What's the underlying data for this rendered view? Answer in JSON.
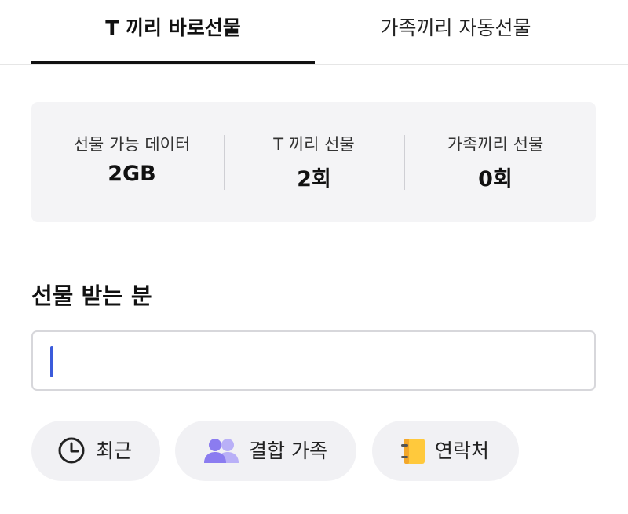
{
  "tabs": {
    "active_label": "T 끼리 바로선물",
    "inactive_label": "가족끼리 자동선물"
  },
  "stats": [
    {
      "label": "선물 가능 데이터",
      "value": "2GB"
    },
    {
      "label": "T 끼리 선물",
      "value": "2회"
    },
    {
      "label": "가족끼리 선물",
      "value": "0회"
    }
  ],
  "recipient": {
    "title": "선물 받는 분",
    "input_value": "",
    "input_placeholder": ""
  },
  "shortcuts": [
    {
      "label": "최근",
      "icon": "clock-icon"
    },
    {
      "label": "결합 가족",
      "icon": "people-icon"
    },
    {
      "label": "연락처",
      "icon": "contact-book-icon"
    }
  ],
  "colors": {
    "accent": "#3b5bdb",
    "tab_underline": "#111111",
    "stats_background": "#f4f4f6",
    "chip_background": "#f1f1f4",
    "people_icon": "#8b7cf0",
    "contact_book": "#ffc93c"
  }
}
